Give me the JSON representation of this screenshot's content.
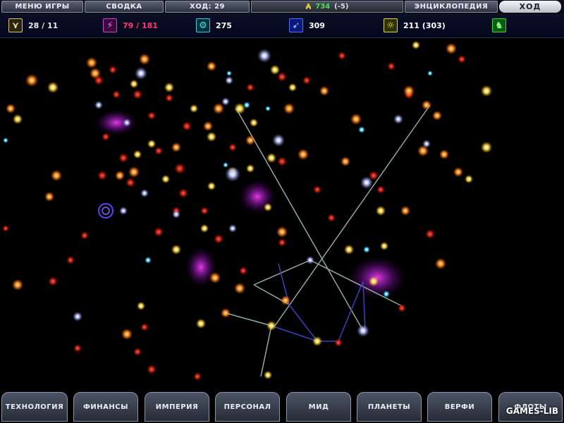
{
  "top_bar": {
    "game_menu": "МЕНЮ ИГРЫ",
    "summary": "СВОДКА",
    "turn": "ХОД: 29",
    "credits_value": "734",
    "credits_delta": "(-5)",
    "encyclopedia": "ЭНЦИКЛОПЕДИЯ",
    "end_turn": "ХОД"
  },
  "resources": {
    "food": "28 / 11",
    "industry": "79 / 181",
    "research": "275",
    "trade": "309",
    "influence": "211 (303)",
    "colors": {
      "food": "#e8e8e8",
      "industry": "#ff3a6a",
      "research": "#ffffff",
      "trade": "#ffffff",
      "influence": "#ffffff"
    }
  },
  "icons": {
    "food": "wheat-icon",
    "industry": "industry-icon",
    "research": "gear-icon",
    "trade": "trade-icon",
    "influence": "lightbulb-icon",
    "military": "military-icon",
    "credits": "credits-icon"
  },
  "bottom_tabs": [
    "ТЕХНОЛОГИЯ",
    "ФИНАНСЫ",
    "ИМПЕРИЯ",
    "ПЕРСОНАЛ",
    "МИД",
    "ПЛАНЕТЫ",
    "ВЕРФИ",
    "ФЛОТЫ"
  ],
  "watermark": "GAMES-LIB"
}
